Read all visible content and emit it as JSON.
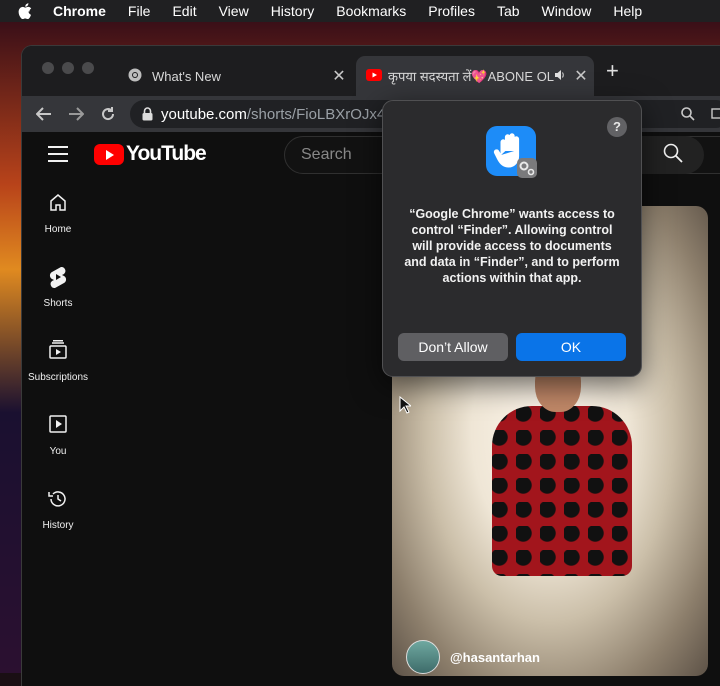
{
  "menubar": {
    "app": "Chrome",
    "items": [
      "File",
      "Edit",
      "View",
      "History",
      "Bookmarks",
      "Profiles",
      "Tab",
      "Window",
      "Help"
    ]
  },
  "tabs": [
    {
      "title": "What's New",
      "icon": "chrome-icon"
    },
    {
      "title": "कृपया सदस्यता लें💖ABONE OL",
      "icon": "youtube-icon",
      "audio": true
    }
  ],
  "omnibox": {
    "host": "youtube.com",
    "path": "/shorts/FioLBXrOJx4"
  },
  "youtube": {
    "logo": "YouTube",
    "search_placeholder": "Search",
    "sidebar": [
      {
        "label": "Home",
        "icon": "home-icon"
      },
      {
        "label": "Shorts",
        "icon": "shorts-icon"
      },
      {
        "label": "Subscriptions",
        "icon": "subscriptions-icon"
      },
      {
        "label": "You",
        "icon": "you-icon"
      },
      {
        "label": "History",
        "icon": "history-icon"
      }
    ],
    "short": {
      "channel": "@hasantarhan"
    }
  },
  "dialog": {
    "message": "“Google Chrome” wants access to control “Finder”. Allowing control will provide access to documents and data in “Finder”, and to perform actions within that app.",
    "help": "?",
    "deny_label": "Don’t Allow",
    "ok_label": "OK",
    "accent": "#0a74e8"
  }
}
